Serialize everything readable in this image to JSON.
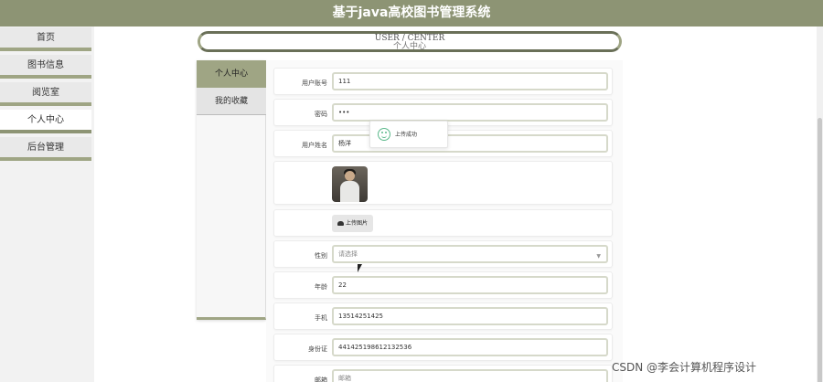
{
  "header": {
    "title": "基于java高校图书管理系统"
  },
  "sidebar": {
    "items": [
      {
        "label": "首页"
      },
      {
        "label": "图书信息"
      },
      {
        "label": "阅览室"
      },
      {
        "label": "个人中心"
      },
      {
        "label": "后台管理"
      }
    ],
    "active_index": 3
  },
  "center": {
    "title_en": "USER / CENTER",
    "title_cn": "个人中心"
  },
  "tabs": [
    {
      "label": "个人中心",
      "active": true
    },
    {
      "label": "我的收藏",
      "active": false
    }
  ],
  "form": {
    "account": {
      "label": "用户账号",
      "value": "111"
    },
    "password": {
      "label": "密码",
      "value": "•••"
    },
    "name": {
      "label": "用户姓名",
      "value": "杨洋"
    },
    "upload": {
      "label": "上传图片"
    },
    "gender": {
      "label": "性别",
      "placeholder": "请选择"
    },
    "age": {
      "label": "年龄",
      "value": "22"
    },
    "phone": {
      "label": "手机",
      "value": "13514251425"
    },
    "idcard": {
      "label": "身份证",
      "value": "441425198612132536"
    },
    "email": {
      "label": "邮箱",
      "placeholder": "邮箱"
    }
  },
  "toast": {
    "message": "上传成功"
  },
  "watermark": {
    "text": "CSDN @李会计算机程序设计"
  },
  "colors": {
    "accent": "#8d9474",
    "accent_light": "#9fa584",
    "success": "#5ab88a"
  },
  "icons": {
    "upload": "cloud-upload-icon",
    "toast": "smile-icon",
    "select": "chevron-down-icon"
  }
}
